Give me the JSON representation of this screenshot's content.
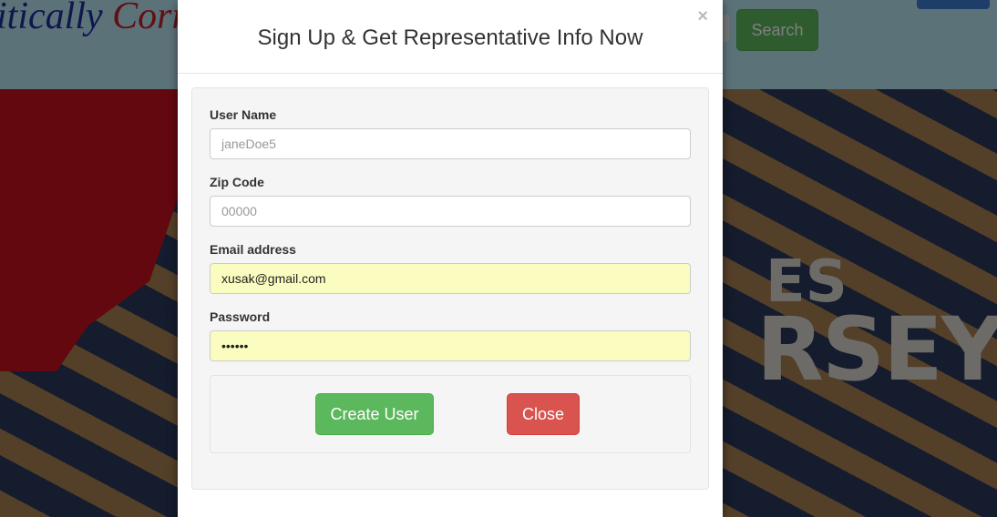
{
  "background": {
    "brand_part1": "itically ",
    "brand_part2": "Corr",
    "search_button_label": "Search",
    "hero_text_line1": "ES",
    "hero_text_line2": "RSEY"
  },
  "modal": {
    "title": "Sign Up & Get Representative Info Now",
    "close_symbol": "×",
    "fields": [
      {
        "label": "User Name",
        "value": "",
        "placeholder": "janeDoe5"
      },
      {
        "label": "Zip Code",
        "value": "",
        "placeholder": "00000"
      },
      {
        "label": "Email address",
        "value": "xusak@gmail.com",
        "placeholder": ""
      },
      {
        "label": "Password",
        "value": "••••••",
        "placeholder": ""
      }
    ],
    "create_button_label": "Create User",
    "close_button_label": "Close"
  },
  "colors": {
    "primary_success": "#5cb85c",
    "danger": "#d9534f",
    "autofill": "#fbfdc0"
  }
}
